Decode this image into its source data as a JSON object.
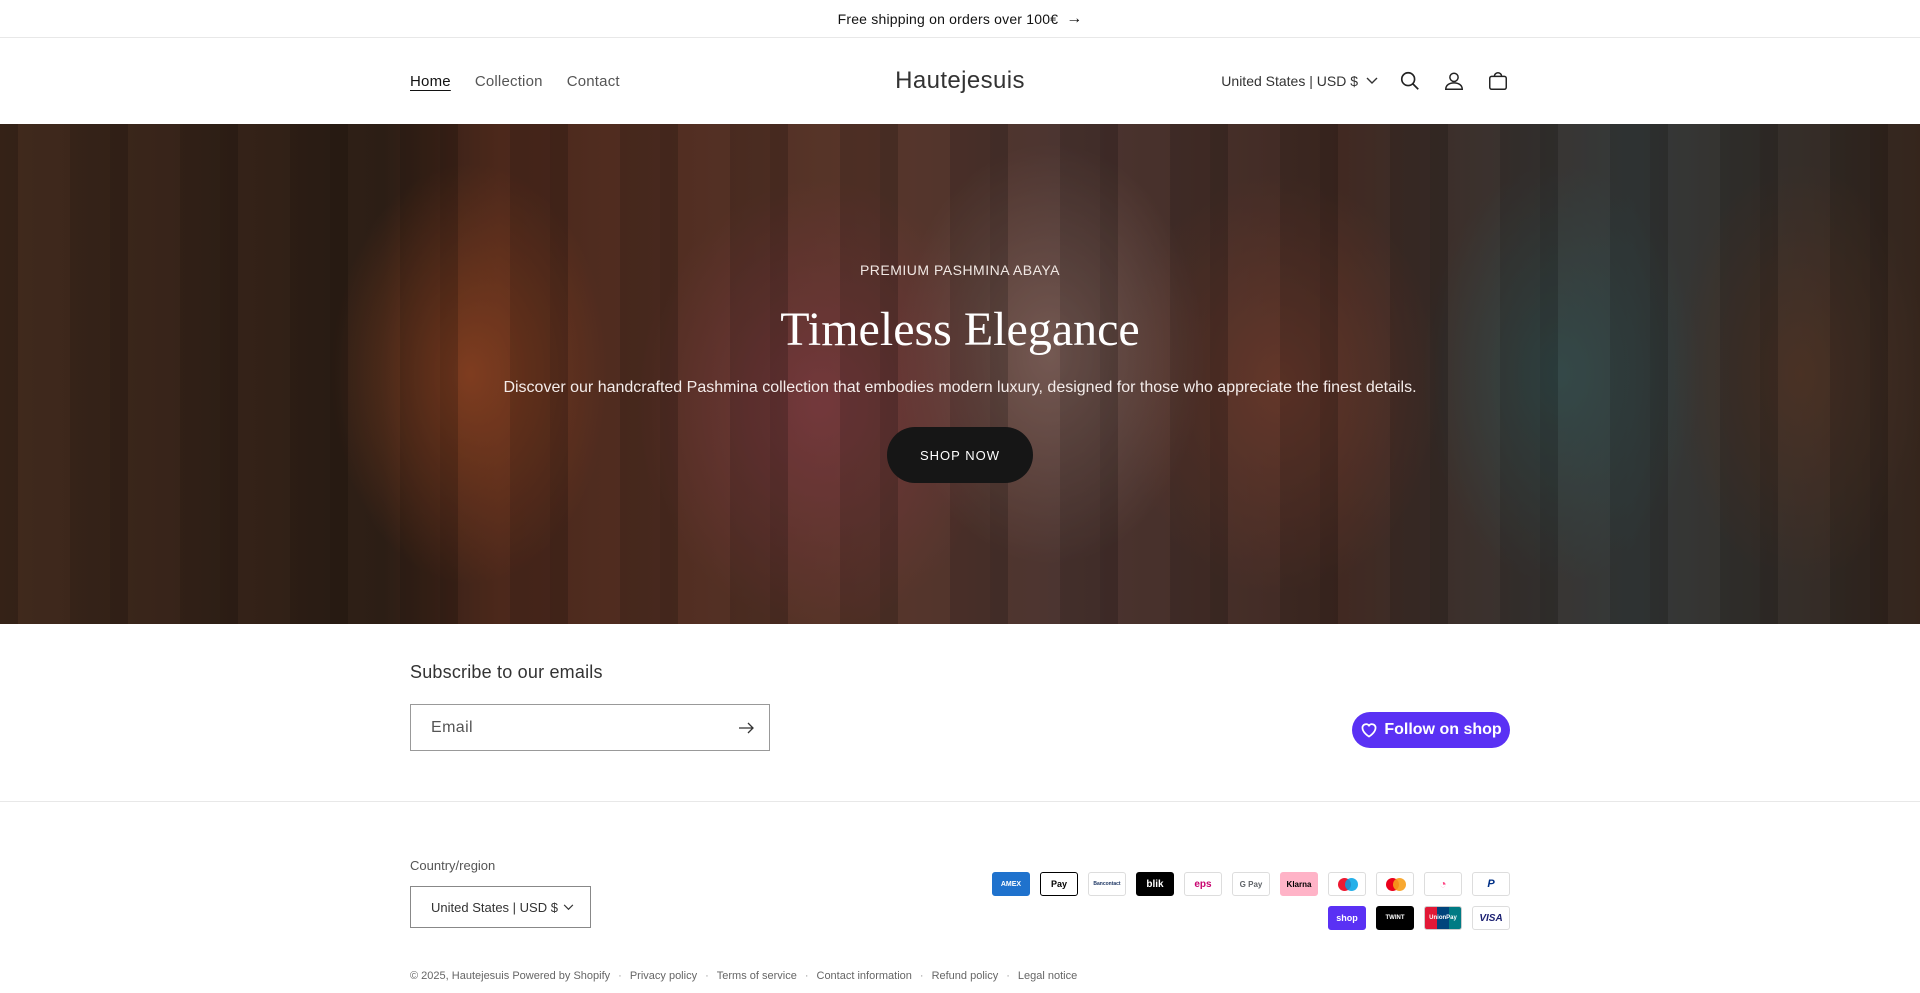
{
  "announcement": {
    "text": "Free shipping on orders over 100€",
    "arrow": "→"
  },
  "header": {
    "nav": [
      "Home",
      "Collection",
      "Contact"
    ],
    "brand": "Hautejesuis",
    "locale": "United States | USD $"
  },
  "hero": {
    "kicker": "PREMIUM PASHMINA ABAYA",
    "title": "Timeless Elegance",
    "subtitle": "Discover our handcrafted Pashmina collection that embodies modern luxury, designed for those who appreciate the finest details.",
    "cta": "SHOP NOW"
  },
  "subscribe": {
    "title": "Subscribe to our emails",
    "placeholder": "Email",
    "follow_label": "Follow on shop"
  },
  "footer": {
    "country_label": "Country/region",
    "country_value": "United States | USD $",
    "payments_row1": [
      "AMEX",
      "Pay",
      "Bancontact",
      "blik",
      "eps",
      "G Pay",
      "Klarna",
      "Maestro",
      "Mastercard",
      "Payconiq",
      "PayPal"
    ],
    "payments_row2": [
      "shop",
      "TWINT",
      "UnionPay",
      "VISA"
    ],
    "copyright": "© 2025,",
    "shop_name": "Hautejesuis",
    "powered": "Powered by Shopify",
    "links": [
      "Privacy policy",
      "Terms of service",
      "Contact information",
      "Refund policy",
      "Legal notice"
    ]
  },
  "colors": {
    "shop_purple": "#5a31f4",
    "button_dark": "#161616"
  }
}
